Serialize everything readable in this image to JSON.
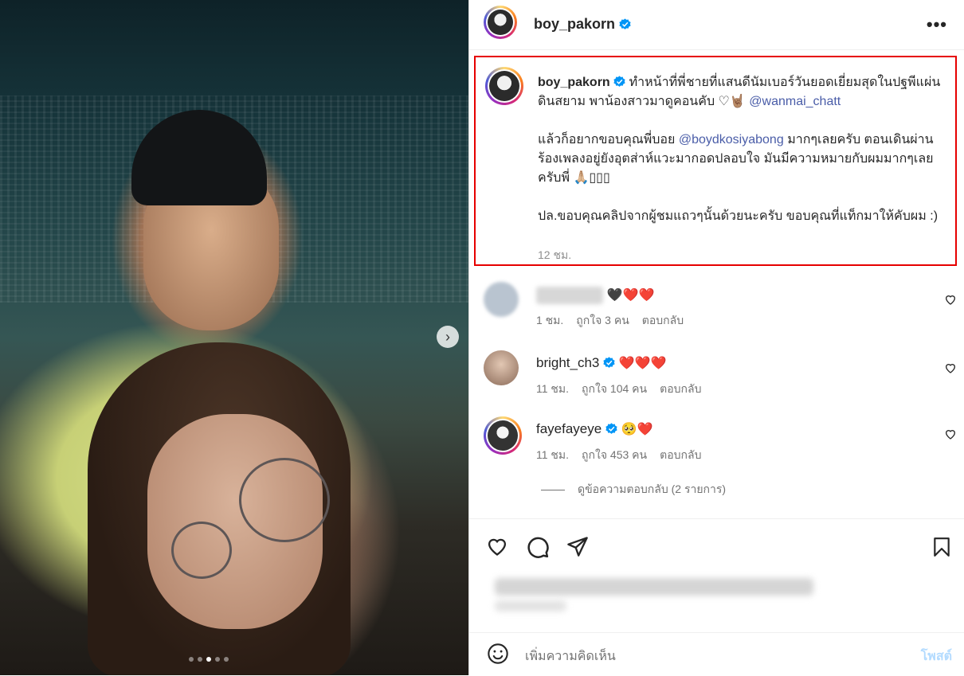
{
  "post": {
    "username": "boy_pakorn",
    "caption_p1": "ทำหน้าที่พี่ชายที่แสนดีนัมเบอร์วันยอดเยี่ยมสุดในปฐพีแผ่นดินสยาม พาน้องสาวมาดูคอนคับ ♡🤘🏽",
    "mention1": "@wanmai_chatt",
    "caption_p2a": "แล้วก็อยากขอบคุณพี่บอย",
    "mention2": "@boydkosiyabong",
    "caption_p2b": "มากๆเลยครับ ตอนเดินผ่านร้องเพลงอยู่ยังอุตส่าห์แวะมากอดปลอบใจ มันมีความหมายกับผมมากๆเลยครับพี่ 🙏🏼▯▯▯",
    "caption_p3": "ปล.ขอบคุณคลิปจากผู้ชมแถวๆนั้นด้วยนะครับ ขอบคุณที่แท็กมาให้คับผม :)",
    "time": "12 ชม."
  },
  "comments": [
    {
      "name": "",
      "text": "🖤❤️❤️",
      "time": "1 ชม.",
      "likes": "ถูกใจ 3 คน",
      "reply": "ตอบกลับ"
    },
    {
      "name": "bright_ch3",
      "text": "❤️❤️❤️",
      "time": "11 ชม.",
      "likes": "ถูกใจ 104 คน",
      "reply": "ตอบกลับ"
    },
    {
      "name": "fayefayeye",
      "text": "🥺❤️",
      "time": "11 ชม.",
      "likes": "ถูกใจ 453 คน",
      "reply": "ตอบกลับ"
    }
  ],
  "view_replies": "ดูข้อความตอบกลับ (2 รายการ)",
  "add_comment": {
    "placeholder": "เพิ่มความคิดเห็น",
    "post_label": "โพสต์"
  },
  "more_icon": "•••",
  "colors": {
    "verified": "#0095f6",
    "highlight_border": "#e60000",
    "mention": "#4a5da8"
  }
}
